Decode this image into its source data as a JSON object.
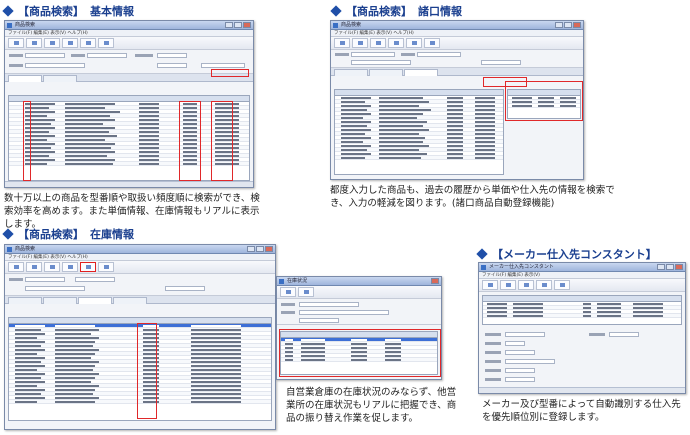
{
  "sections": [
    {
      "tag": "【商品検索】",
      "subtitle": "基本情報",
      "caption": "数十万以上の商品を型番順や取扱い頻度順に検索ができ、検索効率を高めます。また単価情報、在庫情報もリアルに表示します。"
    },
    {
      "tag": "【商品検索】",
      "subtitle": "諸口情報",
      "caption": "都度入力した商品も、過去の履歴から単価や仕入先の情報を検索でき、入力の軽減を図ります。(諸口商品自動登録機能)"
    },
    {
      "tag": "【商品検索】",
      "subtitle": "在庫情報",
      "caption": "自営業倉庫の在庫状況のみならず、他営業所の在庫状況もリアルに把握でき、商品の振り替え作業を促します。"
    },
    {
      "tag": "",
      "subtitle": "【メーカー仕入先コンスタント】",
      "caption": "メーカー及び型番によって自動識別する仕入先を優先順位別に登録します。"
    }
  ],
  "windows": {
    "basic": {
      "title": "商品検索",
      "menu": "ファイル(F)  編集(E)  表示(V)  ヘルプ(H)",
      "status": ""
    },
    "misc": {
      "title": "商品検索",
      "menu": "ファイル(F)  編集(E)  表示(V)  ヘルプ(H)"
    },
    "stock": {
      "title": "商品検索",
      "menu": "ファイル(F)  編集(E)  表示(V)  ヘルプ(H)"
    },
    "stock_popup": {
      "title": "在庫状況"
    },
    "maker": {
      "title": "メーカー仕入先コンスタント",
      "menu": "ファイル(F)  編集(E)  表示(V)"
    }
  },
  "colors": {
    "accent": "#1a3f8f",
    "highlight": "#e0282a",
    "selection": "#3d6fd6"
  }
}
